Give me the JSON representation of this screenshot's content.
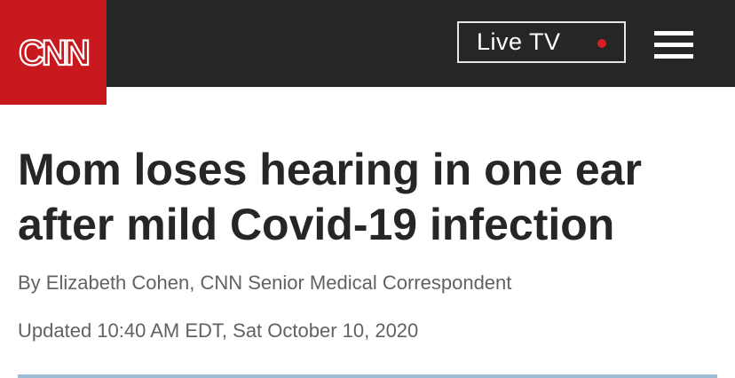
{
  "header": {
    "logo_text": "CNN",
    "live_tv_label": "Live TV",
    "menu_icon": "hamburger-menu-icon",
    "colors": {
      "bar": "#262626",
      "logo_bg": "#c8191f",
      "live_dot": "#d61f26"
    }
  },
  "article": {
    "headline_line1": "Mom loses hearing in one ear",
    "headline_line2": "after mild Covid-19 infection",
    "byline": "By Elizabeth Cohen, CNN Senior Medical Correspondent",
    "updated": "Updated 10:40 AM EDT, Sat October 10, 2020"
  }
}
